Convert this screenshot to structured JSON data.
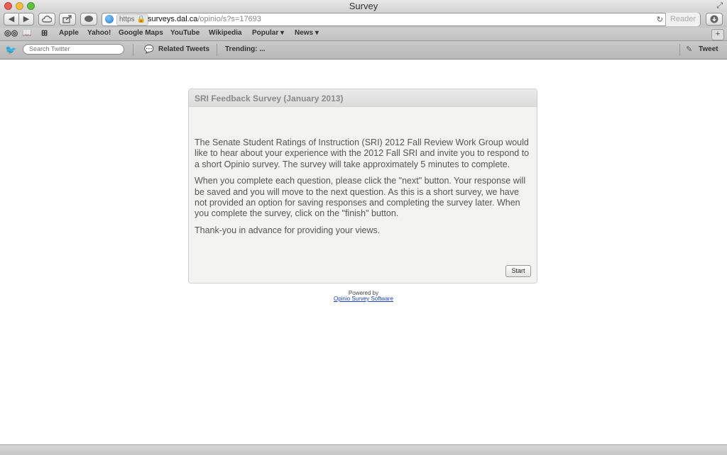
{
  "window": {
    "title": "Survey"
  },
  "nav": {
    "back": "◀",
    "forward": "▶",
    "https_label": "https",
    "url_host": "surveys.dal.ca",
    "url_path": "/opinio/s?s=17693",
    "reader": "Reader"
  },
  "bookmarks": [
    "Apple",
    "Yahoo!",
    "Google Maps",
    "YouTube",
    "Wikipedia",
    "Popular ▾",
    "News ▾"
  ],
  "twitter": {
    "search_placeholder": "Search Twitter",
    "related": "Related Tweets",
    "trending": "Trending: ...",
    "tweet": "Tweet"
  },
  "survey": {
    "title": "SRI Feedback Survey (January 2013)",
    "paragraphs": [
      "The Senate Student Ratings of Instruction (SRI) 2012 Fall Review Work Group would like to hear about your experience with the 2012 Fall SRI and invite you to respond to a short Opinio survey. The survey will take approximately 5 minutes to complete.",
      "When you complete each question, please click the \"next\" button. Your response will be saved and you will move to the next question. As this is a short survey, we have not provided an option for saving responses and completing the survey later. When you complete the survey, click on the \"finish\" button.",
      "Thank-you in advance for providing your views."
    ],
    "start_button": "Start"
  },
  "footer": {
    "powered_by": "Powered by",
    "software_link": "Opinio Survey Software"
  }
}
